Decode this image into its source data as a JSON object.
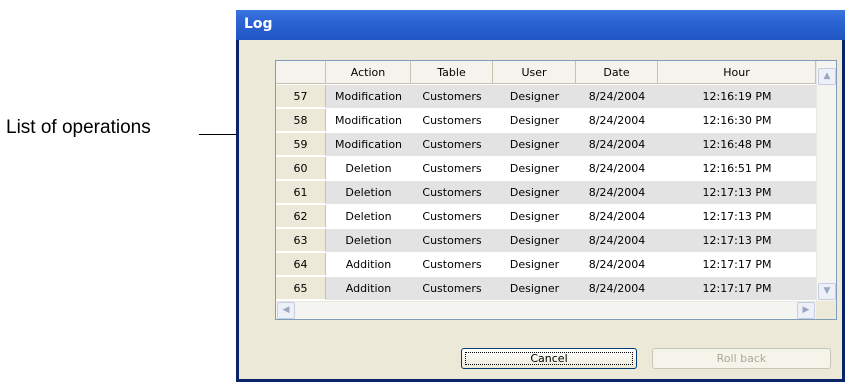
{
  "callout": {
    "label": "List of operations"
  },
  "window": {
    "title": "Log"
  },
  "table": {
    "columns": [
      "Action",
      "Table",
      "User",
      "Date",
      "Hour"
    ],
    "rows": [
      {
        "id": "57",
        "action": "Modification",
        "table": "Customers",
        "user": "Designer",
        "date": "8/24/2004",
        "hour": "12:16:19 PM"
      },
      {
        "id": "58",
        "action": "Modification",
        "table": "Customers",
        "user": "Designer",
        "date": "8/24/2004",
        "hour": "12:16:30 PM"
      },
      {
        "id": "59",
        "action": "Modification",
        "table": "Customers",
        "user": "Designer",
        "date": "8/24/2004",
        "hour": "12:16:48 PM"
      },
      {
        "id": "60",
        "action": "Deletion",
        "table": "Customers",
        "user": "Designer",
        "date": "8/24/2004",
        "hour": "12:16:51 PM"
      },
      {
        "id": "61",
        "action": "Deletion",
        "table": "Customers",
        "user": "Designer",
        "date": "8/24/2004",
        "hour": "12:17:13 PM"
      },
      {
        "id": "62",
        "action": "Deletion",
        "table": "Customers",
        "user": "Designer",
        "date": "8/24/2004",
        "hour": "12:17:13 PM"
      },
      {
        "id": "63",
        "action": "Deletion",
        "table": "Customers",
        "user": "Designer",
        "date": "8/24/2004",
        "hour": "12:17:13 PM"
      },
      {
        "id": "64",
        "action": "Addition",
        "table": "Customers",
        "user": "Designer",
        "date": "8/24/2004",
        "hour": "12:17:17 PM"
      },
      {
        "id": "65",
        "action": "Addition",
        "table": "Customers",
        "user": "Designer",
        "date": "8/24/2004",
        "hour": "12:17:17 PM"
      }
    ]
  },
  "buttons": {
    "cancel": "Cancel",
    "rollback": "Roll back"
  },
  "icons": {
    "scroll_up": "chevron-up-icon",
    "scroll_down": "chevron-down-icon",
    "scroll_left": "chevron-left-icon",
    "scroll_right": "chevron-right-icon"
  },
  "colors": {
    "title_bar": "#2b63d2",
    "client_bg": "#ece9d8",
    "grid_border": "#7f9db9",
    "row_shade": "#e3e3e3"
  }
}
